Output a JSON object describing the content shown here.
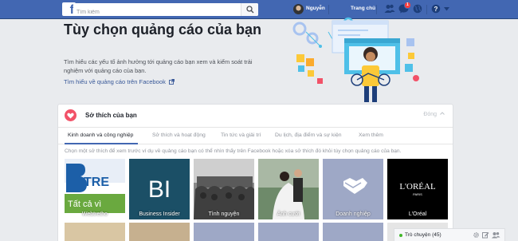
{
  "topbar": {
    "logo_letter": "f",
    "search_placeholder": "Tìm kiếm",
    "user_name": "Nguyễn",
    "home_label": "Trang chủ",
    "friend_requests_badge": "",
    "notifications_badge": "1",
    "colors": {
      "bar": "#4267b2",
      "badge": "#fa3e3e"
    }
  },
  "header": {
    "title": "Tùy chọn quảng cáo của bạn",
    "description": "Tìm hiểu các yếu tố ảnh hưởng tới quảng cáo bạn xem và kiểm soát trải nghiệm với quảng cáo của bạn.",
    "learn_more_link": "Tìm hiểu về quảng cáo trên Facebook"
  },
  "interests": {
    "title": "Sở thích của bạn",
    "close_label": "Đóng",
    "tabs": [
      {
        "label": "Kinh doanh và công nghiệp",
        "active": true
      },
      {
        "label": "Sở thích và hoạt động",
        "active": false
      },
      {
        "label": "Tin tức và giải trí",
        "active": false
      },
      {
        "label": "Du lịch, địa điểm và sự kiện",
        "active": false
      },
      {
        "label": "Xem thêm",
        "active": false
      }
    ],
    "helper_text": "Chọn một sở thích để xem trước ví dụ về quảng cáo bạn có thể nhìn thấy trên Facebook hoặc xóa sở thích đó khỏi tùy chọn quảng cáo của bạn.",
    "tiles": [
      {
        "label": "Webtretho",
        "logo_text": "TRE",
        "banner_text": "Tất cả vì"
      },
      {
        "label": "Business Insider",
        "logo_text": "BI"
      },
      {
        "label": "Tình nguyện"
      },
      {
        "label": "Ảnh cưới"
      },
      {
        "label": "Doanh nghiệp"
      },
      {
        "label": "L'Oréal",
        "logo_text": "L'ORÉAL",
        "logo_sub": "PARIS"
      }
    ]
  },
  "chat": {
    "label": "Trò chuyện (45)",
    "status_color": "#42b72a"
  }
}
